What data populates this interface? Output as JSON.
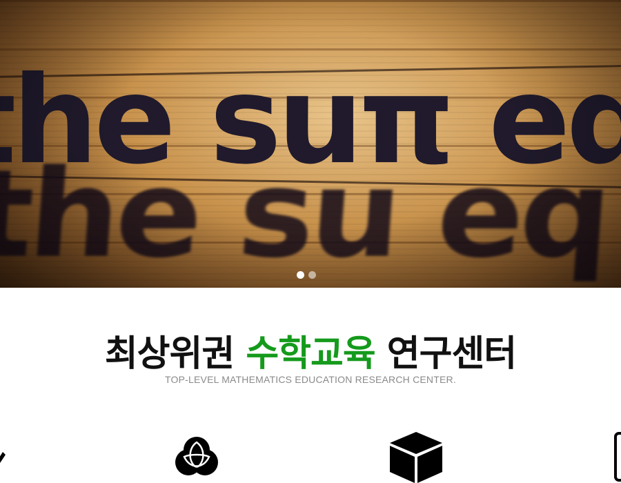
{
  "hero": {
    "image_text": "the sum eq",
    "slides": [
      {
        "label": "slide-1",
        "active": true
      },
      {
        "label": "slide-2",
        "active": false
      }
    ]
  },
  "headline": {
    "part1": "최상위권 ",
    "accent": "수학교육",
    "part2": " 연구센터",
    "accent_color": "#159a1c"
  },
  "subheadline": "TOP-LEVEL MATHEMATICS EDUCATION RESEARCH CENTER.",
  "features": [
    {
      "icon": "trinity-circles-icon"
    },
    {
      "icon": "cube-icon"
    },
    {
      "icon": "tablet-icon"
    },
    {
      "icon": "arrow-icon"
    }
  ]
}
